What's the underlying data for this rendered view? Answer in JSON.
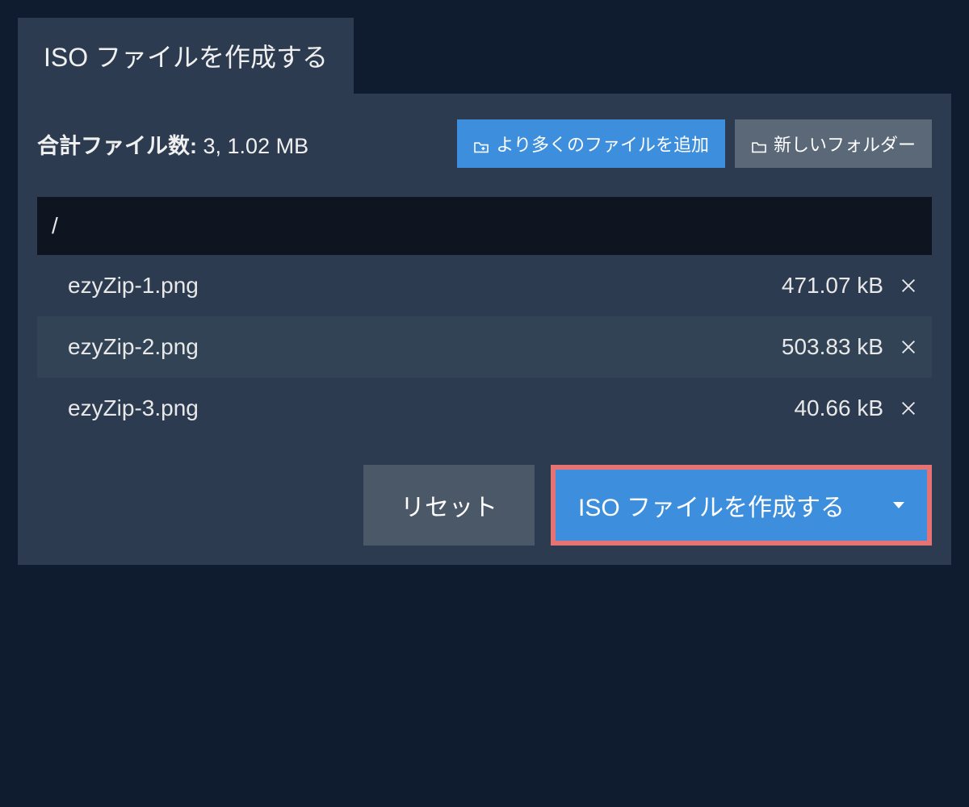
{
  "tab": {
    "title": "ISO ファイルを作成する"
  },
  "summary": {
    "label": "合計ファイル数:",
    "value": "3, 1.02 MB"
  },
  "buttons": {
    "add_files": "より多くのファイルを追加",
    "new_folder": "新しいフォルダー",
    "reset": "リセット",
    "create_iso": "ISO ファイルを作成する"
  },
  "path": "/",
  "files": [
    {
      "name": "ezyZip-1.png",
      "size": "471.07 kB"
    },
    {
      "name": "ezyZip-2.png",
      "size": "503.83 kB"
    },
    {
      "name": "ezyZip-3.png",
      "size": "40.66 kB"
    }
  ]
}
